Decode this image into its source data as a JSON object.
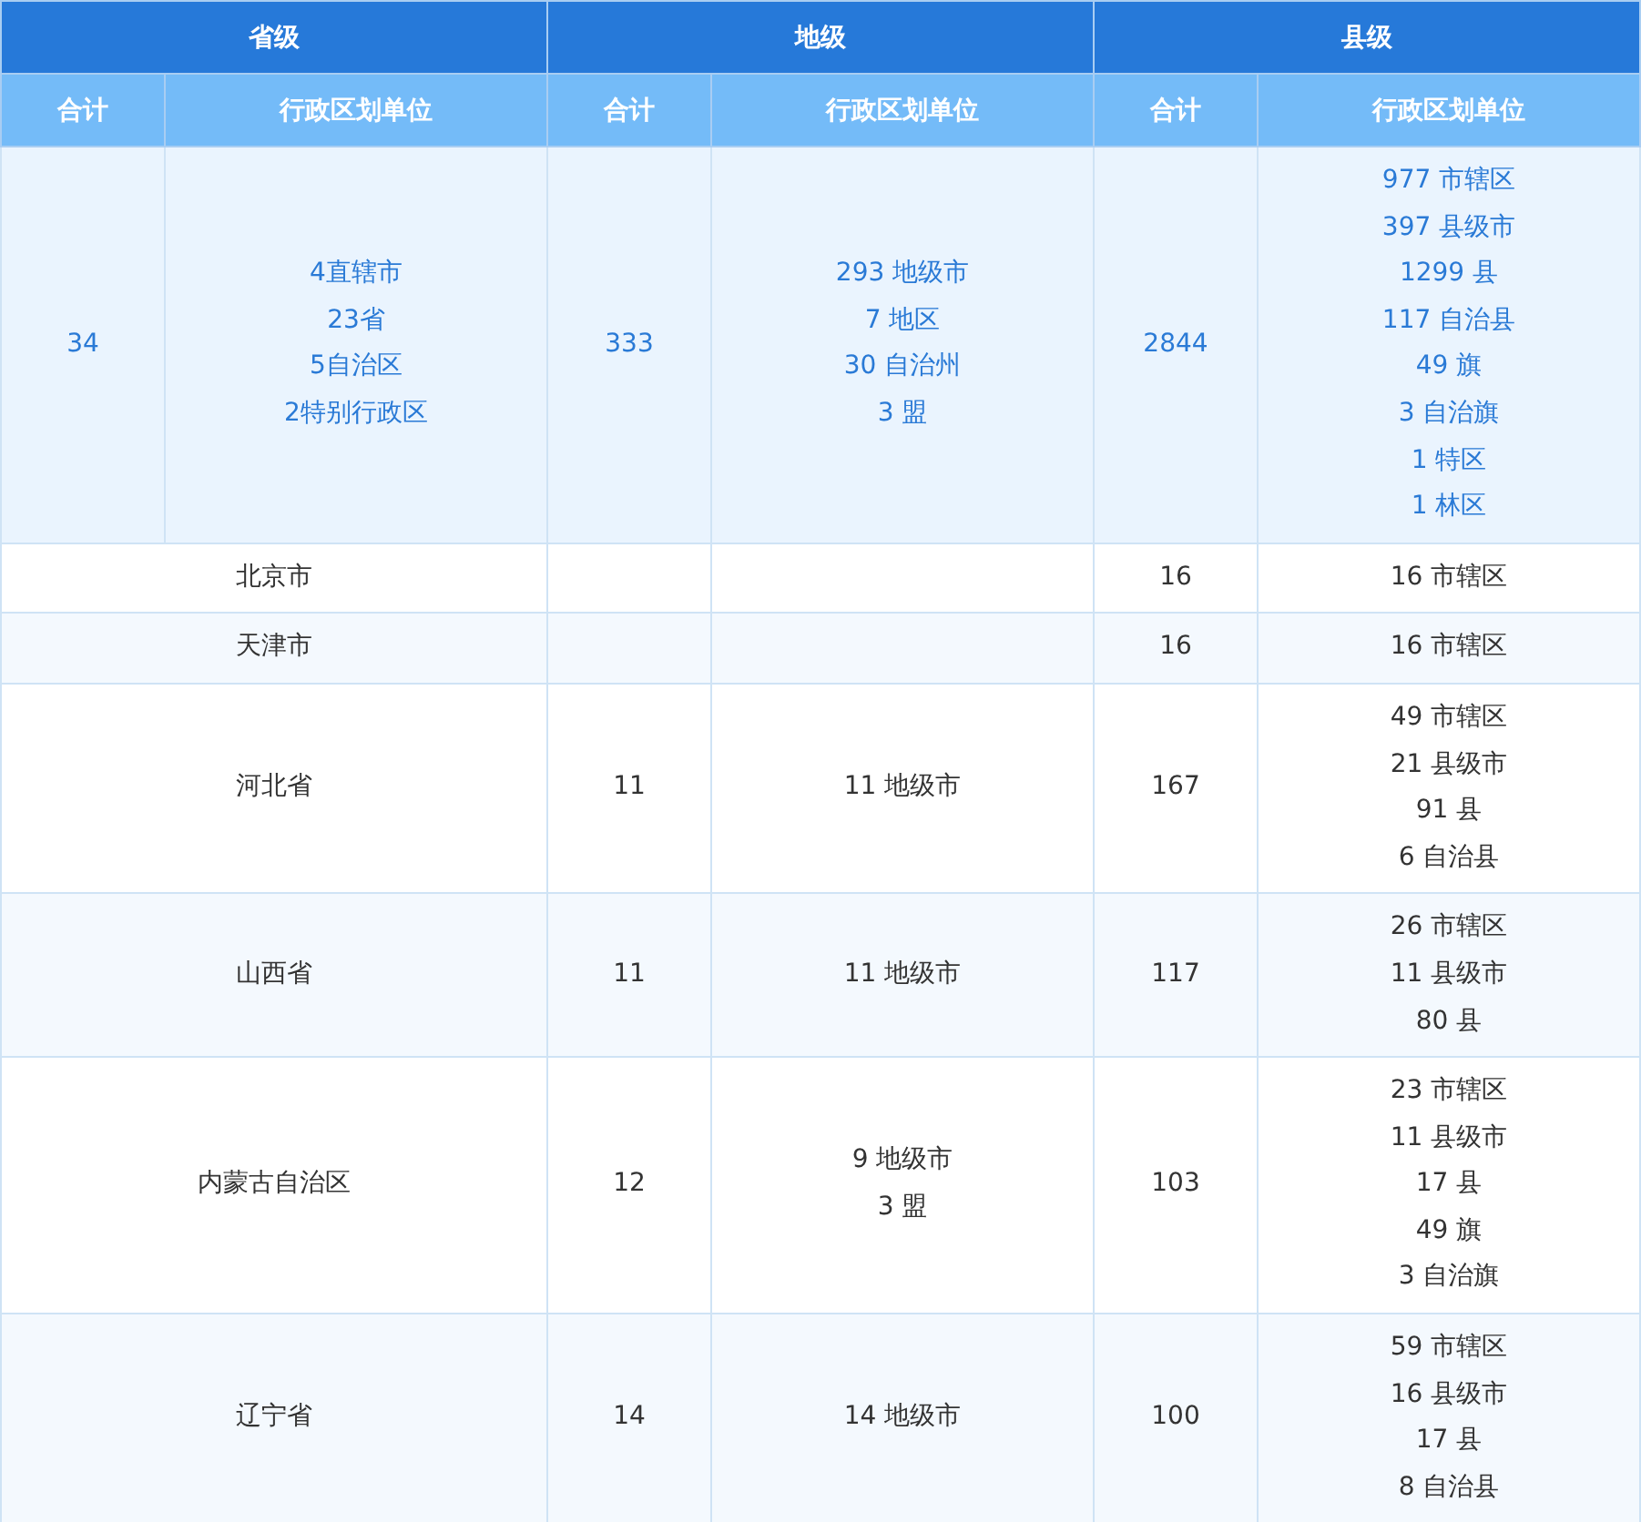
{
  "header_groups": [
    "省级",
    "地级",
    "县级"
  ],
  "sub_headers": [
    "合计",
    "行政区划单位",
    "合计",
    "行政区划单位",
    "合计",
    "行政区划单位"
  ],
  "summary": {
    "province_total": "34",
    "province_units": [
      "4直辖市",
      "23省",
      "5自治区",
      "2特别行政区"
    ],
    "prefecture_total": "333",
    "prefecture_units": [
      "293 地级市",
      "7 地区",
      "30 自治州",
      "3 盟"
    ],
    "county_total": "2844",
    "county_units": [
      "977 市辖区",
      "397 县级市",
      "1299 县",
      "117 自治县",
      "49 旗",
      "3 自治旗",
      "1 特区",
      "1 林区"
    ]
  },
  "rows": [
    {
      "name": "北京市",
      "county_total": "16",
      "county_units": [
        "16 市辖区"
      ]
    },
    {
      "name": "天津市",
      "county_total": "16",
      "county_units": [
        "16 市辖区"
      ]
    },
    {
      "name": "河北省",
      "prefecture_total": "11",
      "prefecture_units": [
        "11 地级市"
      ],
      "county_total": "167",
      "county_units": [
        "49 市辖区",
        "21 县级市",
        "91 县",
        "6 自治县"
      ]
    },
    {
      "name": "山西省",
      "prefecture_total": "11",
      "prefecture_units": [
        "11 地级市"
      ],
      "county_total": "117",
      "county_units": [
        "26 市辖区",
        "11 县级市",
        "80 县"
      ]
    },
    {
      "name": "内蒙古自治区",
      "prefecture_total": "12",
      "prefecture_units": [
        "9 地级市",
        "3 盟"
      ],
      "county_total": "103",
      "county_units": [
        "23 市辖区",
        "11 县级市",
        "17 县",
        "49 旗",
        "3 自治旗"
      ]
    },
    {
      "name": "辽宁省",
      "prefecture_total": "14",
      "prefecture_units": [
        "14 地级市"
      ],
      "county_total": "100",
      "county_units": [
        "59 市辖区",
        "16 县级市",
        "17 县",
        "8 自治县"
      ]
    }
  ]
}
